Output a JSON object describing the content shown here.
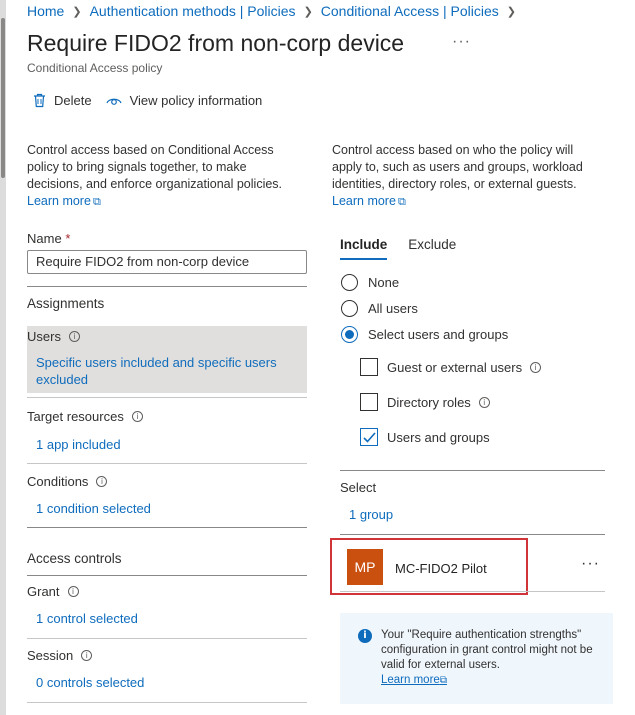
{
  "breadcrumb": [
    "Home",
    "Authentication methods | Policies",
    "Conditional Access | Policies"
  ],
  "header": {
    "title": "Require FIDO2 from non-corp device",
    "more": "···",
    "subtitle": "Conditional Access policy"
  },
  "toolbar": {
    "delete_label": "Delete",
    "view_label": "View policy information"
  },
  "left": {
    "description": "Control access based on Conditional Access policy to bring signals together, to make decisions, and enforce organizational policies.",
    "learn_more": "Learn more",
    "name_label": "Name",
    "name_required": "*",
    "name_value": "Require FIDO2 from non-corp device",
    "assignments_header": "Assignments",
    "users_label": "Users",
    "users_value": "Specific users included and specific users excluded",
    "target_label": "Target resources",
    "target_value": "1 app included",
    "conditions_label": "Conditions",
    "conditions_value": "1 condition selected",
    "access_header": "Access controls",
    "grant_label": "Grant",
    "grant_value": "1 control selected",
    "session_label": "Session",
    "session_value": "0 controls selected"
  },
  "right": {
    "description": "Control access based on who the policy will apply to, such as users and groups, workload identities, directory roles, or external guests.",
    "learn_more": "Learn more",
    "tabs": [
      "Include",
      "Exclude"
    ],
    "radios": [
      "None",
      "All users",
      "Select users and groups"
    ],
    "selected_radio": "Select users and groups",
    "checks": [
      {
        "label": "Guest or external users",
        "checked": false
      },
      {
        "label": "Directory roles",
        "checked": false
      },
      {
        "label": "Users and groups",
        "checked": true
      }
    ],
    "select_label": "Select",
    "select_value": "1 group",
    "member": {
      "initials": "MP",
      "name": "MC-FIDO2 Pilot",
      "more": "···"
    },
    "info_text": "Your \"Require authentication strengths\" configuration in grant control might not be valid for external users.",
    "info_learn_more": "Learn more"
  },
  "colors": {
    "accent": "#0f6cbd",
    "avatar": "#ca5010",
    "highlight_border": "#d13438",
    "info_bg": "#eff6fc"
  },
  "icons": [
    "chevron-right-icon",
    "trash-icon",
    "eye-icon",
    "external-link-icon",
    "info-icon",
    "more-icon",
    "checkmark-icon"
  ]
}
